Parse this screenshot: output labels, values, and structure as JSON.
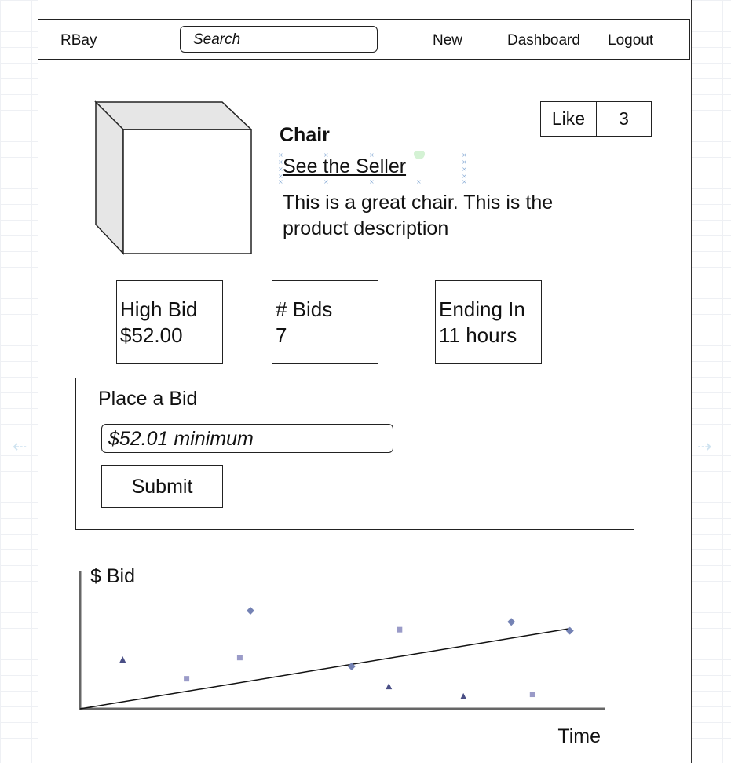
{
  "nav": {
    "brand": "RBay",
    "search_placeholder": "Search",
    "links": [
      "New",
      "Dashboard",
      "Logout"
    ]
  },
  "product": {
    "title": "Chair",
    "seller_link": "See the Seller",
    "description": "This is a great chair.  This is the product description"
  },
  "like": {
    "label": "Like",
    "count": "3"
  },
  "stats": [
    {
      "label": "High Bid",
      "value": "$52.00"
    },
    {
      "label": "# Bids",
      "value": "7"
    },
    {
      "label": "Ending In",
      "value": "11 hours"
    }
  ],
  "bid_form": {
    "title": "Place a Bid",
    "placeholder": "$52.01 minimum",
    "submit_label": "Submit"
  },
  "chart_data": {
    "type": "scatter",
    "xlabel": "Time",
    "ylabel": "$ Bid",
    "points": [
      {
        "x": 0.08,
        "y": 0.44,
        "shape": "triangle"
      },
      {
        "x": 0.2,
        "y": 0.27,
        "shape": "square"
      },
      {
        "x": 0.3,
        "y": 0.46,
        "shape": "square"
      },
      {
        "x": 0.32,
        "y": 0.88,
        "shape": "diamond"
      },
      {
        "x": 0.51,
        "y": 0.38,
        "shape": "diamond"
      },
      {
        "x": 0.58,
        "y": 0.2,
        "shape": "triangle"
      },
      {
        "x": 0.6,
        "y": 0.71,
        "shape": "square"
      },
      {
        "x": 0.72,
        "y": 0.11,
        "shape": "triangle"
      },
      {
        "x": 0.81,
        "y": 0.78,
        "shape": "diamond"
      },
      {
        "x": 0.85,
        "y": 0.13,
        "shape": "square"
      },
      {
        "x": 0.92,
        "y": 0.7,
        "shape": "diamond"
      }
    ],
    "trend_line": {
      "x": [
        0.0,
        0.92
      ],
      "y": [
        0.0,
        0.72
      ]
    },
    "xlim": [
      0,
      1
    ],
    "ylim": [
      0,
      1
    ]
  }
}
